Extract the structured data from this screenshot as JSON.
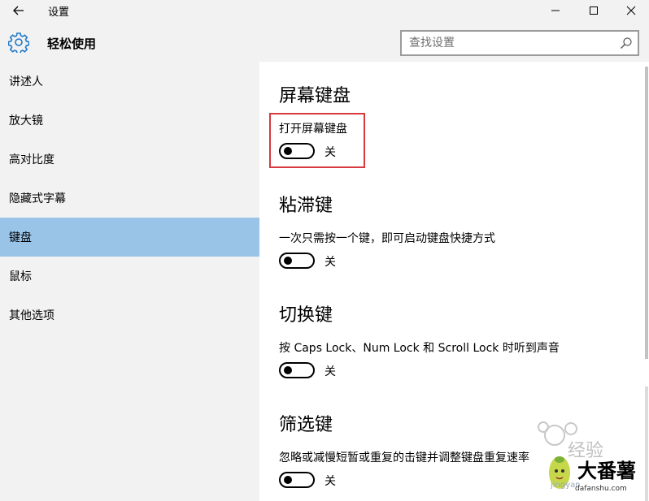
{
  "window": {
    "title": "设置",
    "controls": [
      "minimize",
      "maximize",
      "close"
    ]
  },
  "header": {
    "icon": "gear-icon",
    "title": "轻松使用",
    "search_placeholder": "查找设置"
  },
  "sidebar": {
    "selected": 4,
    "items": [
      {
        "label": "讲述人"
      },
      {
        "label": "放大镜"
      },
      {
        "label": "高对比度"
      },
      {
        "label": "隐藏式字幕"
      },
      {
        "label": "键盘"
      },
      {
        "label": "鼠标"
      },
      {
        "label": "其他选项"
      }
    ]
  },
  "sections": [
    {
      "heading": "屏幕键盘",
      "description": "打开屏幕键盘",
      "toggle_state": "关",
      "toggle_on": false,
      "highlighted": true
    },
    {
      "heading": "粘滞键",
      "description": "一次只需按一个键，即可启动键盘快捷方式",
      "toggle_state": "关",
      "toggle_on": false
    },
    {
      "heading": "切换键",
      "description": "按 Caps Lock、Num Lock 和 Scroll Lock 时听到声音",
      "toggle_state": "关",
      "toggle_on": false
    },
    {
      "heading": "筛选键",
      "description": "忽略或减慢短暂或重复的击键并调整键盘重复速率",
      "toggle_state": "关",
      "toggle_on": false
    }
  ],
  "watermark": {
    "brand": "大番薯",
    "site": "jingyan",
    "domain": "dafanshu.com",
    "text": "经验"
  },
  "colors": {
    "chrome_bg": "#f2f2f2",
    "selected_nav": "#99c4e8",
    "highlight_border": "#d8393d",
    "accent_icon": "#1e78c8"
  }
}
